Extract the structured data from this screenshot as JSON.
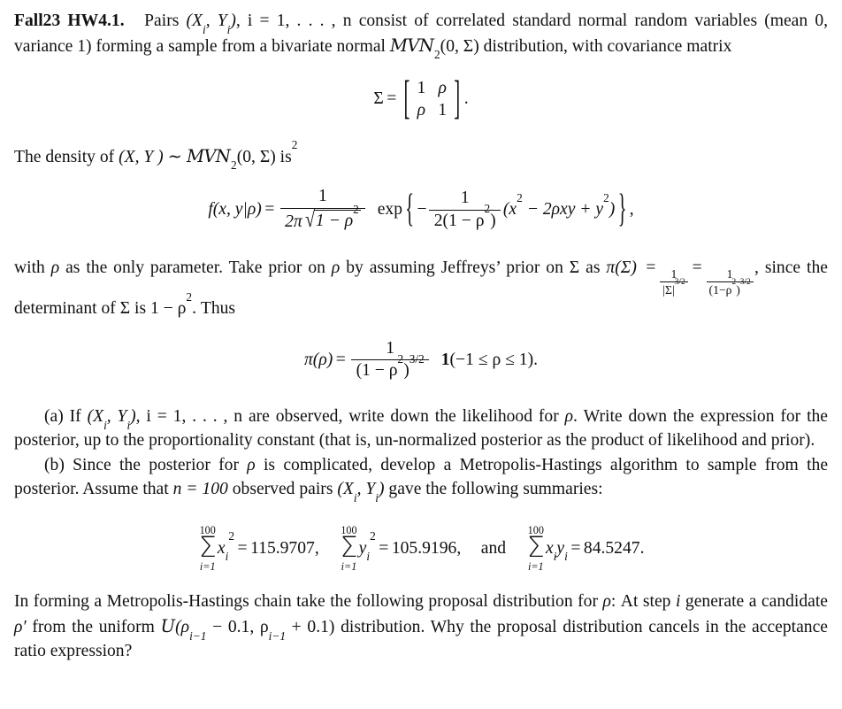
{
  "document": {
    "type": "homework-problem",
    "label": "Fall23 HW4.1.",
    "intro": {
      "text_1": "Pairs",
      "text_2": "consist of correlated standard normal random variables (mean 0, variance 1) forming a sample from a bivariate normal",
      "text_3": "distribution, with covariance matrix",
      "pairs_sym": "(X",
      "i_sub": "i",
      "comma": ", Y",
      "close": ")",
      "index_range": ", i = 1, . . . , n",
      "mvn": "MVN",
      "mvn_sub": "2",
      "mvn_args": "(0, Σ)"
    },
    "sigma_matrix": {
      "lhs": "Σ",
      "equals": "=",
      "entries": [
        "1",
        "ρ",
        "ρ",
        "1"
      ],
      "terminator": "."
    },
    "density_lead": {
      "prefix": "The density of",
      "rv": "(X, Y )",
      "tilde": "∼",
      "mvn": "MVN",
      "mvn_sub": "2",
      "mvn_args": "(0, Σ)",
      "is": "is",
      "footnote_marker": "2"
    },
    "density_eq": {
      "f": "f",
      "args": "(x, y|ρ)",
      "equals": "=",
      "frac_num": "1",
      "frac_den_prefix": "2π",
      "frac_den_radicand": "1 − ρ",
      "frac_den_radicand_sup": "2",
      "exp": "exp",
      "brace_open": "{",
      "minus": "−",
      "inner_num": "1",
      "inner_den": "2(1 − ρ",
      "inner_den_sup": "2",
      "inner_den_close": ")",
      "quad_form": "(x",
      "quad_sup1": "2",
      "quad_mid": " − 2ρxy + y",
      "quad_sup2": "2",
      "quad_close": ")",
      "brace_close": "}",
      "terminator": ","
    },
    "prior_lead": {
      "part_1": "with",
      "rho": "ρ",
      "part_2": "as the only parameter. Take prior on",
      "part_3": "by assuming Jeffreys’ prior on",
      "sigma": "Σ",
      "part_4": "as",
      "pi_sigma": "π(Σ)",
      "equals": "=",
      "frac1_num": "1",
      "frac1_den": "|Σ|",
      "frac1_den_sup": "3/2",
      "frac2_num": "1",
      "frac2_den": "(1−ρ",
      "frac2_den_sup1": "2",
      "frac2_den_mid": ")",
      "frac2_den_sup2": "3/2",
      "part_5": ", since the determinant of",
      "part_6": "is 1 − ρ",
      "part_6_sup": "2",
      "part_7": ". Thus"
    },
    "prior_eq": {
      "lhs": "π(ρ)",
      "equals": "=",
      "num": "1",
      "den": "(1 − ρ",
      "den_sup1": "2",
      "den_mid": ")",
      "den_sup2": "3/2",
      "indicator": "1",
      "indicator_args": "(−1 ≤ ρ ≤ 1)",
      "terminator": "."
    },
    "part_a": {
      "marker": "(a)",
      "text_1": "If",
      "obs": "(X",
      "obs_sub1": "i",
      "obs_mid": ", Y",
      "obs_sub2": "i",
      "obs_close": ")",
      "index_range": ", i = 1, . . . , n",
      "text_2": "are observed, write down the likelihood for",
      "rho": "ρ",
      "text_3": ". Write down the expression for the posterior, up to the proportionality constant (that is, un-normalized posterior as the product of likelihood and prior)."
    },
    "part_b": {
      "marker": "(b)",
      "text_1": "Since the posterior for",
      "rho": "ρ",
      "text_2": "is complicated, develop a Metropolis-Hastings algorithm to sample from the posterior. Assume that",
      "n_eq": "n = 100",
      "text_3": "observed pairs",
      "pairs": "(X",
      "pairs_sub1": "i",
      "pairs_mid": ", Y",
      "pairs_sub2": "i",
      "pairs_close": ")",
      "text_4": "gave the following summaries:"
    },
    "summaries": [
      {
        "upper": "100",
        "lower": "i=1",
        "term": "x",
        "term_sub": "i",
        "term_sup": "2",
        "equals": "=",
        "value": "115.9707",
        "terminator": ","
      },
      {
        "upper": "100",
        "lower": "i=1",
        "term": "y",
        "term_sub": "i",
        "term_sup": "2",
        "equals": "=",
        "value": "105.9196",
        "terminator": ","
      },
      {
        "upper": "100",
        "lower": "i=1",
        "term": "x",
        "term_sub": "i",
        "term2": "y",
        "term2_sub": "i",
        "equals": "=",
        "value": "84.5247",
        "terminator": "."
      }
    ],
    "summaries_conjunction": "and",
    "closing": {
      "text_1": "In forming a Metropolis-Hastings chain take the following proposal distribution for",
      "rho": "ρ",
      "text_2": ": At step",
      "i": "i",
      "text_3": "generate a candidate",
      "rho_prime": "ρ′",
      "text_4": "from the uniform",
      "unif": "U",
      "unif_args_open": "(ρ",
      "unif_sub1": "i−1",
      "unif_mid": " − 0.1, ρ",
      "unif_sub2": "i−1",
      "unif_close": " + 0.1)",
      "text_5": "distribution. Why the proposal distribution cancels in the acceptance ratio expression?"
    },
    "colors": {
      "background": "#ffffff",
      "text": "#111111",
      "rule": "#111111"
    }
  }
}
